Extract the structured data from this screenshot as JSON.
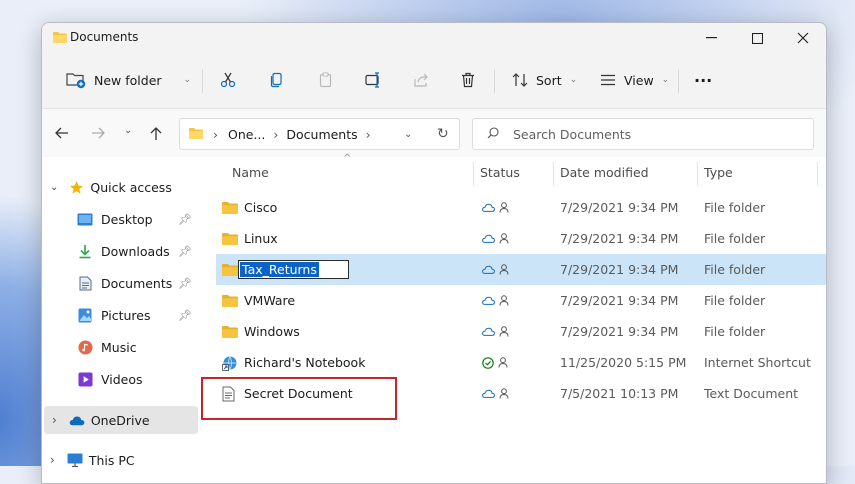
{
  "window": {
    "title": "Documents"
  },
  "toolbar": {
    "new_folder_label": "New folder",
    "sort_label": "Sort",
    "view_label": "View",
    "more_label": "···"
  },
  "address": {
    "segments": [
      "One...",
      "Documents"
    ],
    "search_placeholder": "Search Documents"
  },
  "sidebar": {
    "quick_access": "Quick access",
    "items": [
      {
        "label": "Desktop",
        "icon": "desktop-icon",
        "pinned": true
      },
      {
        "label": "Downloads",
        "icon": "download-icon",
        "pinned": true
      },
      {
        "label": "Documents",
        "icon": "documents-icon",
        "pinned": true
      },
      {
        "label": "Pictures",
        "icon": "pictures-icon",
        "pinned": true
      },
      {
        "label": "Music",
        "icon": "music-icon",
        "pinned": false
      },
      {
        "label": "Videos",
        "icon": "videos-icon",
        "pinned": false
      }
    ],
    "onedrive": "OneDrive",
    "thispc": "This PC"
  },
  "columns": {
    "name": "Name",
    "status": "Status",
    "date": "Date modified",
    "type": "Type"
  },
  "files": [
    {
      "name": "Cisco",
      "date": "7/29/2021 9:34 PM",
      "type": "File folder",
      "kind": "folder",
      "status": "cloud"
    },
    {
      "name": "Linux",
      "date": "7/29/2021 9:34 PM",
      "type": "File folder",
      "kind": "folder",
      "status": "cloud"
    },
    {
      "name": "Tax_Returns",
      "date": "7/29/2021 9:34 PM",
      "type": "File folder",
      "kind": "folder",
      "status": "cloud",
      "renaming": true
    },
    {
      "name": "VMWare",
      "date": "7/29/2021 9:34 PM",
      "type": "File folder",
      "kind": "folder",
      "status": "cloud"
    },
    {
      "name": "Windows",
      "date": "7/29/2021 9:34 PM",
      "type": "File folder",
      "kind": "folder",
      "status": "cloud"
    },
    {
      "name": "Richard's Notebook",
      "date": "11/25/2020 5:15 PM",
      "type": "Internet Shortcut",
      "kind": "shortcut",
      "status": "synced"
    },
    {
      "name": "Secret Document",
      "date": "7/5/2021 10:13 PM",
      "type": "Text Document",
      "kind": "text",
      "status": "cloud"
    }
  ],
  "colors": {
    "selection": "#cce4f7",
    "highlight_border": "#c2262e",
    "rename_selection": "#0a64c8",
    "folder": "#f5c542",
    "onedrive": "#0f6cbd"
  }
}
